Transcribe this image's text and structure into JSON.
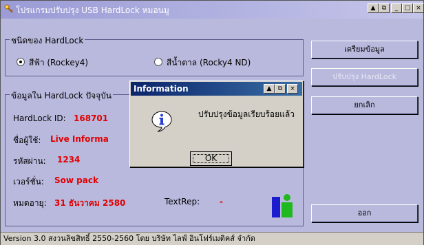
{
  "window": {
    "title": "โปรแกรมปรับปรุง USB HardLock หมอนมู",
    "controls": {
      "min": "_",
      "max": "□",
      "close": "×",
      "extra": "▲ ▣"
    }
  },
  "hardlock_type": {
    "label": "ชนิดของ HardLock",
    "options": [
      {
        "label": "สีฟ้า (Rockey4)",
        "selected": true
      },
      {
        "label": "สีน้ำตาล (Rocky4 ND)",
        "selected": false
      }
    ]
  },
  "info_group": {
    "label": "ข้อมูลใน HardLock ปัจจุบัน",
    "hardlock_id_label": "HardLock ID:",
    "hardlock_id_value": "168701",
    "user_label": "ชื่อผู้ใช้:",
    "user_value": "Live Informa",
    "password_label": "รหัสผ่าน:",
    "password_value": "1234",
    "version_label": "เวอร์ชั่น:",
    "version_value": "Sow pack",
    "expire_label": "หมดอายุ:",
    "expire_value": "31 ธันวาคม 2580",
    "textrep_label": "TextRep:",
    "textrep_value": "-"
  },
  "buttons": {
    "prepare": "เตรียมข้อมูล",
    "update": "ปรับปรุง HardLock",
    "cancel": "ยกเลิก",
    "exit": "ออก"
  },
  "status_bar": "Version 3.0 สงวนลิขสิทธิ์ 2550-2560 โดย บริษัท ไลฟ์ อินโฟร์เมติคส์ จำกัด",
  "dialog": {
    "title": "Information",
    "message": "ปรับปรุงข้อมูลเรียบร้อยแล้ว",
    "ok": "OK"
  },
  "colors": {
    "window_bg": "#b9b9de",
    "accent_red": "#e00000",
    "dialog_title": "#0a246a"
  }
}
